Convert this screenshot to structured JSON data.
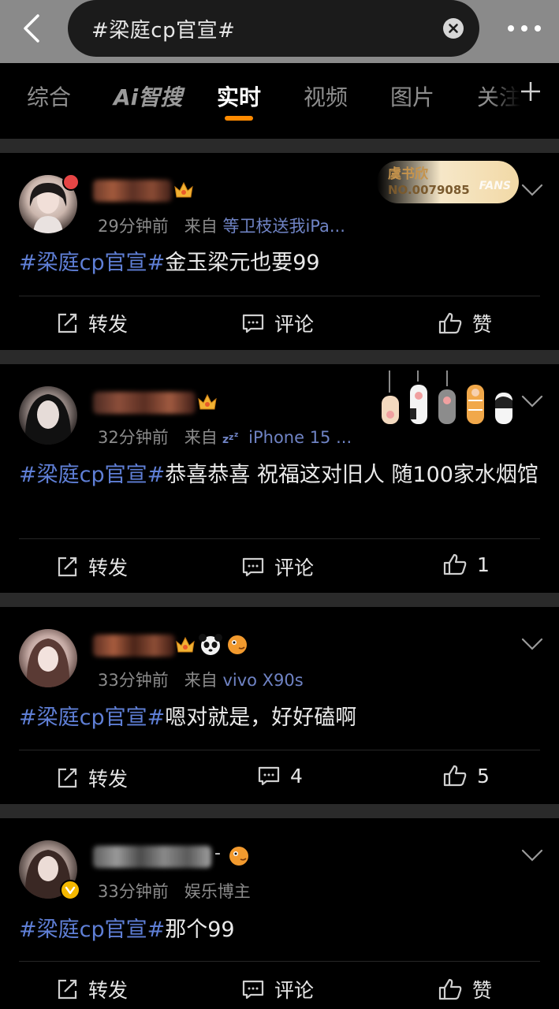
{
  "search": {
    "query": "#梁庭cp官宣#"
  },
  "tabs": [
    {
      "label": "综合"
    },
    {
      "label": "Ai智搜"
    },
    {
      "label": "实时"
    },
    {
      "label": "视频"
    },
    {
      "label": "图片"
    },
    {
      "label": "关注"
    }
  ],
  "active_tab": "实时",
  "colors": {
    "accent": "#ff8a00",
    "hashtag": "#5f7fd6",
    "source": "#6f83c4",
    "background": "#000000"
  },
  "posts": [
    {
      "time": "29分钟前",
      "from_label": "来自",
      "source": "等卫枝送我iPa...",
      "hashtag": "#梁庭cp官宣#",
      "text": "金玉梁元也要99",
      "repost": "转发",
      "comment": "评论",
      "like": "赞",
      "badge": {
        "line1": "虞书欣",
        "line2": "NO.0079085",
        "fans": "FANS"
      }
    },
    {
      "time": "32分钟前",
      "from_label": "来自",
      "source": "iPhone 15 ...",
      "hashtag": "#梁庭cp官宣#",
      "text": "恭喜恭喜 祝福这对旧人 随100家水烟馆",
      "repost": "转发",
      "comment": "评论",
      "like": "1"
    },
    {
      "time": "33分钟前",
      "from_label": "来自",
      "source": "vivo X90s",
      "hashtag": "#梁庭cp官宣#",
      "text": "嗯对就是，好好磕啊",
      "repost": "转发",
      "comment": "4",
      "like": "5"
    },
    {
      "time": "33分钟前",
      "tag": "娱乐博主",
      "hashtag": "#梁庭cp官宣#",
      "text": "那个99",
      "repost": "转发",
      "comment": "评论",
      "like": "赞"
    }
  ]
}
